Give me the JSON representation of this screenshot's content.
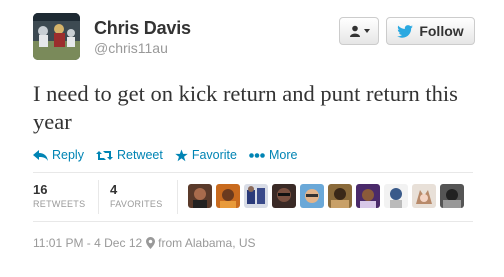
{
  "author": {
    "name": "Chris Davis",
    "handle": "@chris11au"
  },
  "buttons": {
    "follow_label": "Follow"
  },
  "tweet": {
    "text": "I need to get on kick return and punt return this year"
  },
  "actions": {
    "reply": "Reply",
    "retweet": "Retweet",
    "favorite": "Favorite",
    "more": "More"
  },
  "stats": {
    "retweets_count": "16",
    "retweets_label": "RETWEETS",
    "favorites_count": "4",
    "favorites_label": "FAVORITES"
  },
  "footer": {
    "timestamp": "11:01 PM - 4 Dec 12",
    "location": "from Alabama, US"
  },
  "colors": {
    "link": "#0084b4",
    "text": "#333333",
    "muted": "#999999",
    "bird": "#2ba9e1"
  }
}
